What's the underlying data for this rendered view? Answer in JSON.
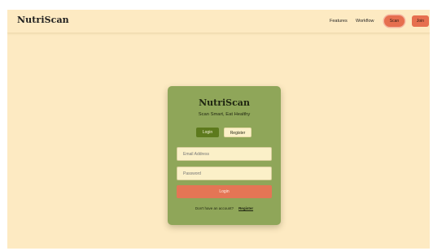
{
  "navbar": {
    "logo": "NutriScan",
    "links": [
      "Features",
      "Workflow"
    ],
    "scan_button": "Scan",
    "join_button": "Join"
  },
  "card": {
    "title": "NutriScan",
    "subtitle": "Scan Smart, Eat Healthy",
    "tabs": {
      "login": "Login",
      "register": "Register",
      "active": "login"
    },
    "email": {
      "placeholder": "Email Address",
      "value": ""
    },
    "password": {
      "placeholder": "Password",
      "value": ""
    },
    "submit_label": "Login",
    "footer_prompt": "Don't have an account?",
    "footer_link": "Register"
  },
  "colors": {
    "background": "#fdeac2",
    "card": "#8fa659",
    "accent": "#e66f4f",
    "active_tab": "#5d7a1d",
    "field": "#fbf0c8"
  }
}
